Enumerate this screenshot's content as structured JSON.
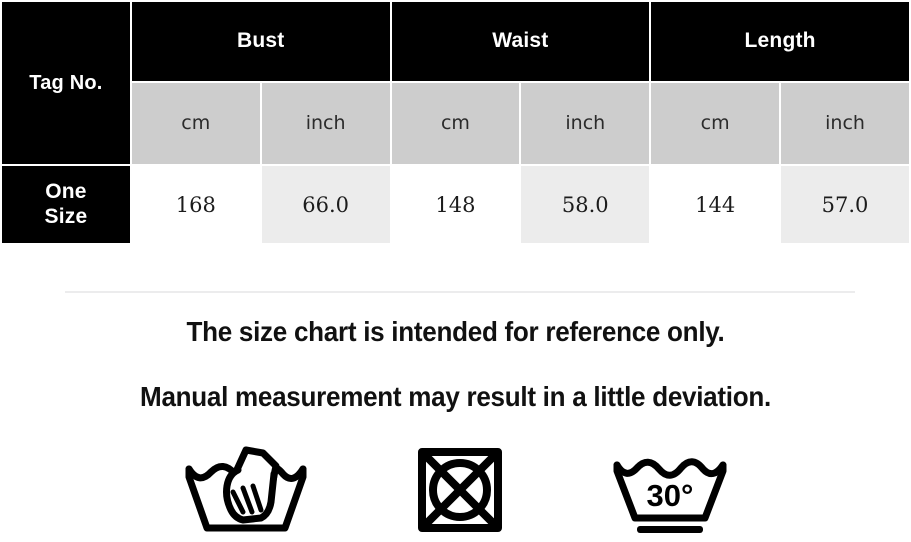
{
  "table": {
    "corner_label": "Tag No.",
    "groups": [
      {
        "label": "Bust"
      },
      {
        "label": "Waist"
      },
      {
        "label": "Length"
      }
    ],
    "units": [
      "cm",
      "inch",
      "cm",
      "inch",
      "cm",
      "inch"
    ],
    "rows": [
      {
        "size_label": "One Size",
        "size_label_line1": "One",
        "size_label_line2": "Size",
        "values": [
          "168",
          "66.0",
          "148",
          "58.0",
          "144",
          "57.0"
        ]
      }
    ]
  },
  "notes": {
    "line1": "The size chart is intended for reference only.",
    "line2": "Manual measurement may result in a little deviation."
  },
  "care_symbols": [
    {
      "name": "hand-wash-icon",
      "label": "Hand wash"
    },
    {
      "name": "do-not-tumble-dry-icon",
      "label": "Do not tumble dry"
    },
    {
      "name": "wash-30-degrees-gentle-icon",
      "label": "30°",
      "temperature": "30°"
    }
  ],
  "colors": {
    "header_black": "#000000",
    "unit_gray": "#cdcdcd",
    "data_alt_gray": "#ececec",
    "divider": "#ececed",
    "text_dark": "#111111"
  }
}
